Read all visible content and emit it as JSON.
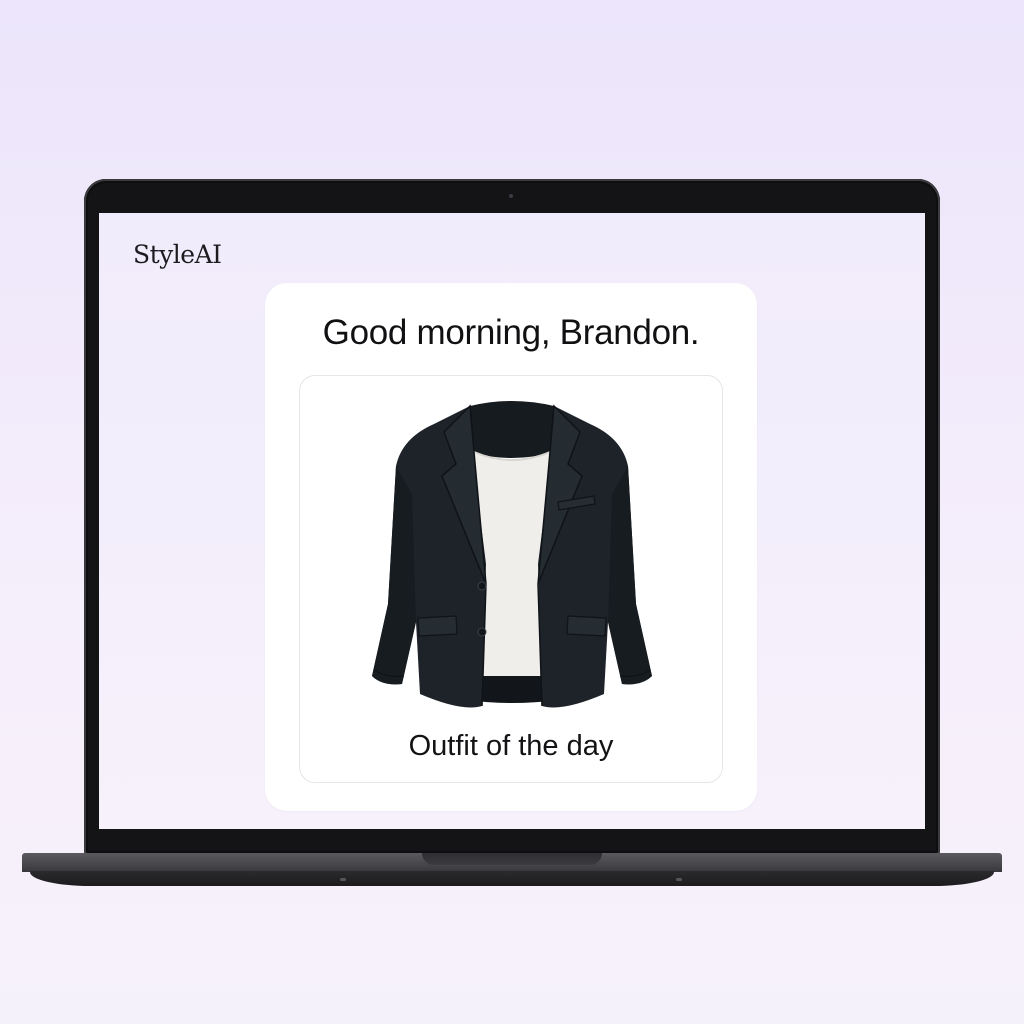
{
  "app": {
    "logo": "StyleAI"
  },
  "main": {
    "greeting": "Good morning, Brandon.",
    "outfit_card": {
      "caption": "Outfit of the day",
      "image_icon": "blazer-icon"
    }
  },
  "colors": {
    "background": "#efe8fb",
    "card": "#ffffff",
    "text": "#111114",
    "jacket": "#1d2329",
    "shirt": "#f1f0ec"
  }
}
